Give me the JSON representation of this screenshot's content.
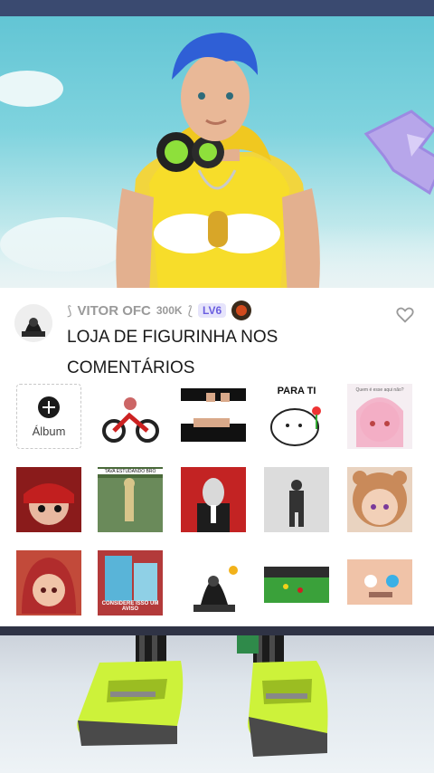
{
  "post": {
    "username": "VITOR OFC",
    "follower_count": "300K",
    "level_badge": "LV6",
    "title": "LOJA DE FIGURINHA NOS COMENTÁRIOS"
  },
  "album": {
    "label": "Álbum"
  },
  "stickers": [
    {
      "caption": ""
    },
    {
      "caption": ""
    },
    {
      "caption": "PARA TI"
    },
    {
      "caption": "Quem é esse aqui não?"
    },
    {
      "caption": ""
    },
    {
      "caption": "TAVA ESTUDANDO BRO"
    },
    {
      "caption": ""
    },
    {
      "caption": ""
    },
    {
      "caption": ""
    },
    {
      "caption": ""
    },
    {
      "caption": "CONSIDERE ISSO UM AVISO"
    },
    {
      "caption": ""
    },
    {
      "caption": ""
    },
    {
      "caption": ""
    }
  ],
  "colors": {
    "accent_level": "#6a5ee0",
    "text_muted": "#9a9a9a",
    "sky": "#6cc8d6"
  }
}
